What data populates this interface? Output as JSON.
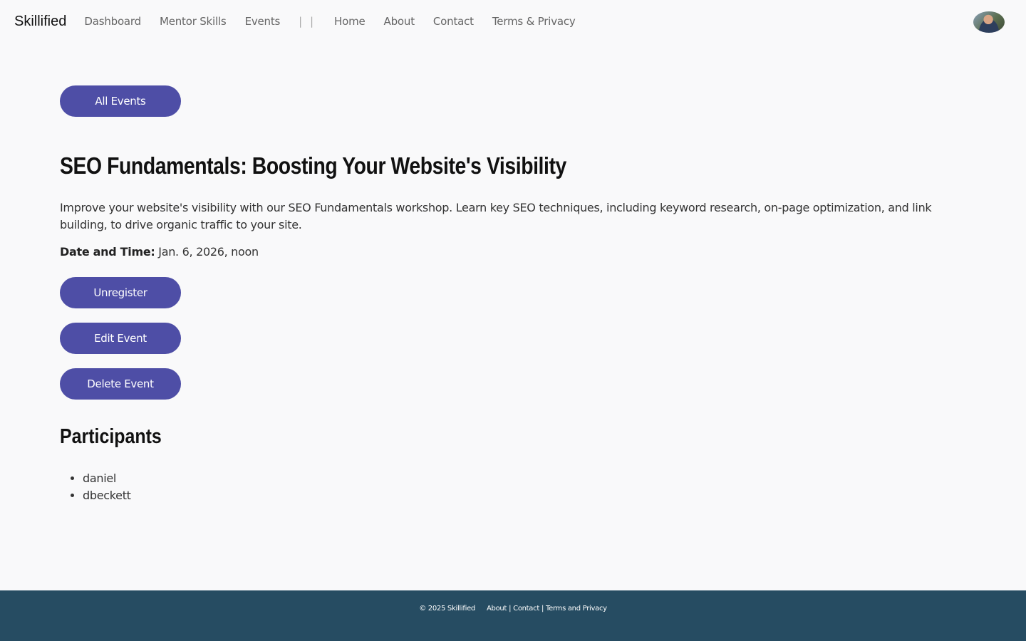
{
  "navbar": {
    "brand": "Skillified",
    "left_links": [
      "Dashboard",
      "Mentor Skills",
      "Events"
    ],
    "separator": "| |",
    "right_links": [
      "Home",
      "About",
      "Contact",
      "Terms & Privacy"
    ]
  },
  "main": {
    "all_events_label": "All Events",
    "title": "SEO Fundamentals: Boosting Your Website's Visibility",
    "description": "Improve your website's visibility with our SEO Fundamentals workshop. Learn key SEO techniques, including keyword research, on-page optimization, and link building, to drive organic traffic to your site.",
    "datetime_label": "Date and Time:",
    "datetime_value": "Jan. 6, 2026, noon",
    "actions": {
      "unregister": "Unregister",
      "edit": "Edit Event",
      "delete": "Delete Event"
    },
    "participants_title": "Participants",
    "participants": [
      "daniel",
      "dbeckett"
    ]
  },
  "footer": {
    "copyright": "© 2025 Skillified",
    "links": [
      "About",
      "Contact",
      "Terms and Privacy"
    ],
    "link_separator": "|"
  },
  "colors": {
    "accent": "#4e4ea6",
    "footer_bg": "#264c62",
    "page_bg": "#f9f9fa"
  }
}
